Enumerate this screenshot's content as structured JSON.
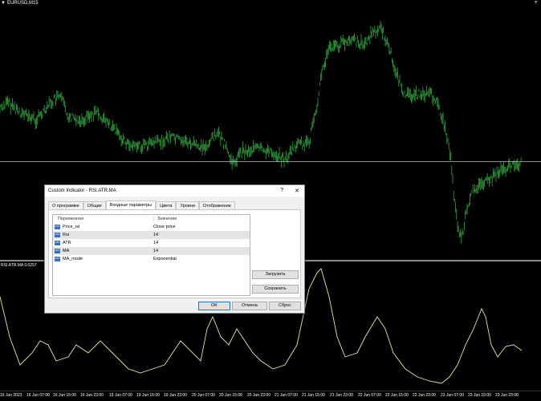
{
  "chart": {
    "symbol": "EURUSD,M15",
    "indicator_label": "RSI.ATR.MA 0.0257",
    "colors": {
      "price": "#2e9a3a",
      "indicator": "#e8e6a0",
      "background": "#000000",
      "separator": "#bdbdbd"
    },
    "time_labels": [
      "15 Jun 2023",
      "16 Jun 07:00",
      "16 Jun 15:00",
      "16 Jun 23:00",
      "19 Jun 07:00",
      "19 Jun 15:00",
      "19 Jun 23:00",
      "20 Jun 07:00",
      "20 Jun 15:00",
      "20 Jun 23:00",
      "21 Jun 07:00",
      "21 Jun 15:00",
      "21 Jun 23:00",
      "22 Jun 07:00",
      "22 Jun 15:00",
      "22 Jun 23:00",
      "23 Jun 07:00",
      "23 Jun 15:00",
      "23 Jun 23:00"
    ]
  },
  "dialog": {
    "title": "Custom Indicator - RSI.ATR.MA",
    "help": "?",
    "close": "✕",
    "tabs": [
      "О программе",
      "Общие",
      "Входные параметры",
      "Цвета",
      "Уровни",
      "Отображение"
    ],
    "active_tab": 2,
    "headers": {
      "variable": "Переменная",
      "value": "Значение"
    },
    "params": [
      {
        "icon": "val",
        "name": "Price_rsi",
        "value": "Close price"
      },
      {
        "icon": "val",
        "name": "Rsi",
        "value": "14"
      },
      {
        "icon": "val",
        "name": "ATR",
        "value": "14"
      },
      {
        "icon": "val",
        "name": "MA",
        "value": "14"
      },
      {
        "icon": "val",
        "name": "MA_mode",
        "value": "Exponential"
      }
    ],
    "load": "Загрузить",
    "save": "Сохранить",
    "ok": "OK",
    "cancel": "Отмена",
    "reset": "Сброс"
  }
}
